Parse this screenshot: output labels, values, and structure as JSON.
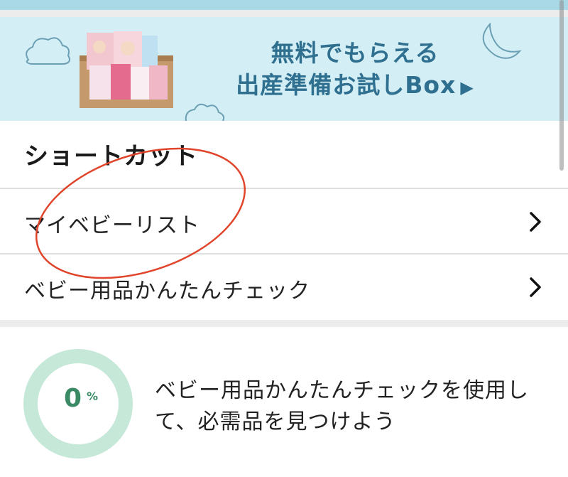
{
  "banner": {
    "line1": "無料でもらえる",
    "line2": "出産準備お試しBox",
    "arrow": "▶"
  },
  "shortcuts": {
    "title": "ショートカット",
    "items": [
      {
        "label": "マイベビーリスト",
        "icon": "chevron-right-icon"
      },
      {
        "label": "ベビー用品かんたんチェック",
        "icon": "chevron-right-icon"
      }
    ]
  },
  "check_progress": {
    "percent": 0,
    "value": "0",
    "unit": "%",
    "description": "ベビー用品かんたんチェックを使用して、必需品を見つけよう"
  },
  "colors": {
    "banner_bg": "#d4eef5",
    "banner_text": "#2f6f8f",
    "ring": "#c5e8d8",
    "percent_text": "#3a8a65",
    "annotation": "#e0442a"
  }
}
